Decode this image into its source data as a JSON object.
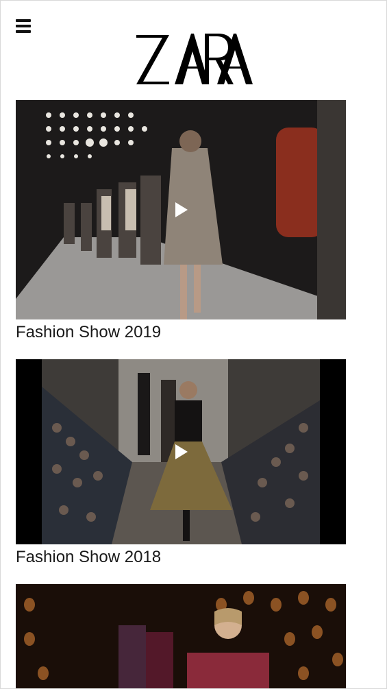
{
  "header": {
    "menu_icon": "hamburger-menu-icon",
    "logo_text": "ZARA"
  },
  "videos": [
    {
      "title": "Fashion Show 2019",
      "icon": "play-icon"
    },
    {
      "title": "Fashion Show 2018",
      "icon": "play-icon"
    },
    {
      "title": "",
      "icon": ""
    }
  ],
  "colors": {
    "text": "#1a1a1a",
    "background": "#ffffff",
    "border": "#d9d9d9"
  }
}
